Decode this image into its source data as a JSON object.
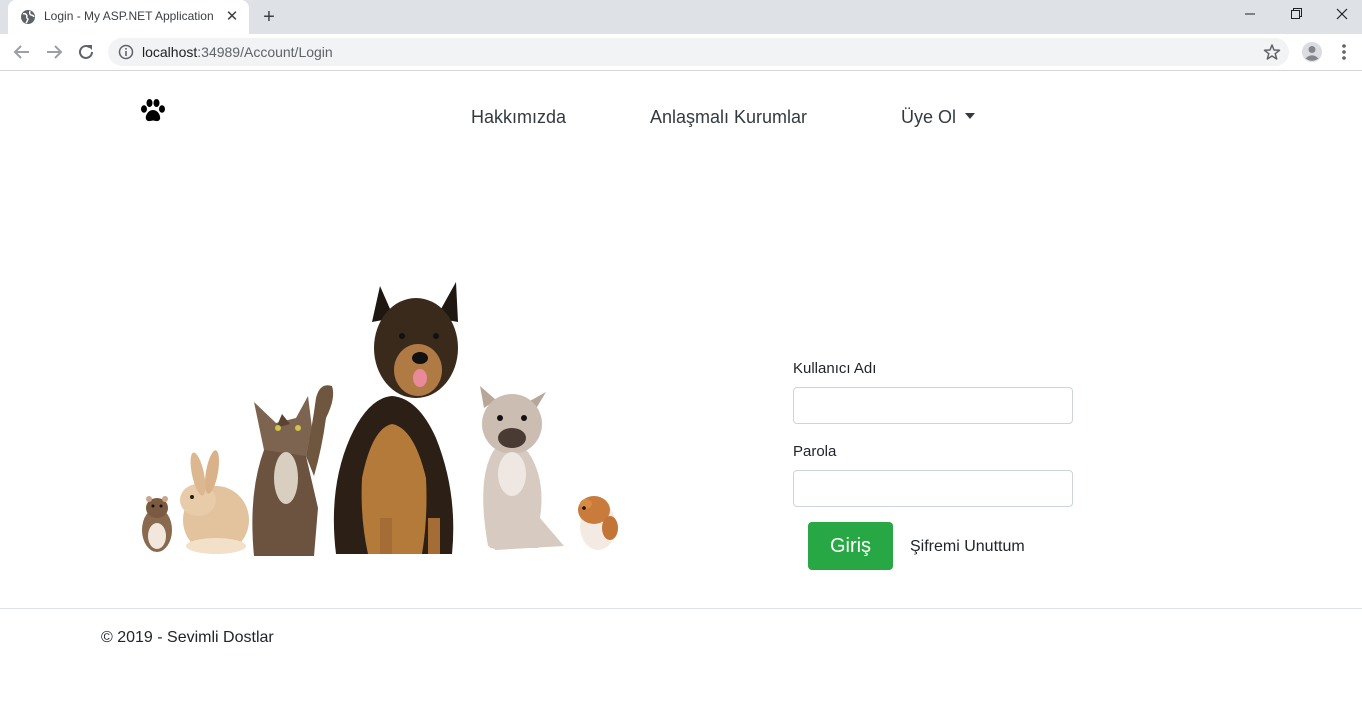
{
  "browser": {
    "tab_title": "Login - My ASP.NET Application",
    "url_host": "localhost",
    "url_path": ":34989/Account/Login"
  },
  "nav": {
    "brand_icon": "paw-icon",
    "about": "Hakkımızda",
    "partners": "Anlaşmalı Kurumlar",
    "signup": "Üye Ol"
  },
  "login": {
    "username_label": "Kullanıcı Adı",
    "username_value": "",
    "password_label": "Parola",
    "password_value": "",
    "submit": "Giriş",
    "forgot": "Şifremi Unuttum"
  },
  "footer": {
    "copyright": "© 2019 - Sevimli Dostlar"
  },
  "colors": {
    "accent": "#28a745",
    "text": "#212529",
    "nav_text": "#343a40"
  }
}
